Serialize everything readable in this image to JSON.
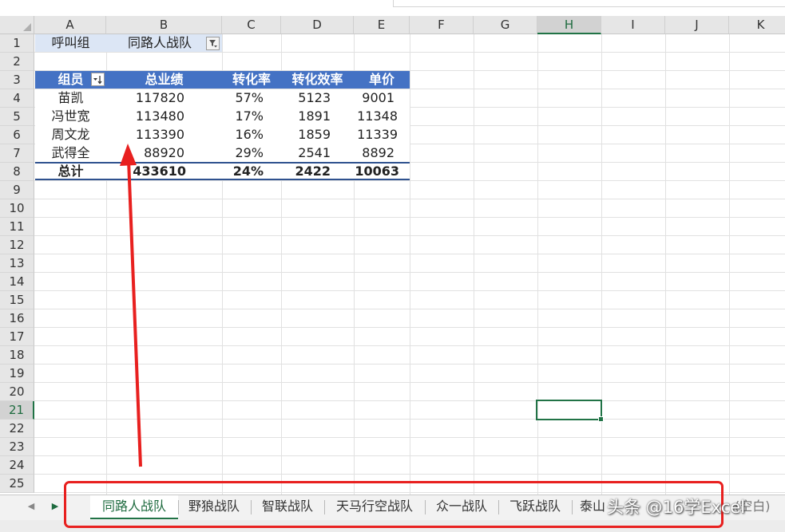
{
  "columns": [
    "A",
    "B",
    "C",
    "D",
    "E",
    "F",
    "G",
    "H",
    "I",
    "J",
    "K"
  ],
  "rows": [
    "1",
    "2",
    "3",
    "4",
    "5",
    "6",
    "7",
    "8",
    "9",
    "10",
    "11",
    "12",
    "13",
    "14",
    "15",
    "16",
    "17",
    "18",
    "19",
    "20",
    "21",
    "22",
    "23",
    "24",
    "25"
  ],
  "active_column": "H",
  "active_row": "21",
  "filter_row": {
    "label": "呼叫组",
    "value": "同路人战队"
  },
  "pivot": {
    "headers": [
      "组员",
      "总业绩",
      "转化率",
      "转化效率",
      "单价"
    ],
    "rows": [
      [
        "苗凯",
        "117820",
        "57%",
        "5123",
        "9001"
      ],
      [
        "冯世宽",
        "113480",
        "17%",
        "1891",
        "11348"
      ],
      [
        "周文龙",
        "113390",
        "16%",
        "1859",
        "11339"
      ],
      [
        "武得全",
        "88920",
        "29%",
        "2541",
        "8892"
      ]
    ],
    "total": [
      "总计",
      "433610",
      "24%",
      "2422",
      "10063"
    ]
  },
  "sheet_tabs": [
    "同路人战队",
    "野狼战队",
    "智联战队",
    "天马行空战队",
    "众一战队",
    "飞跃战队",
    "泰山"
  ],
  "active_sheet": "同路人战队",
  "tab_tail_text": "(空白)",
  "watermark": "头条 @16学Excel",
  "colors": {
    "accent": "#217346",
    "pivot_header": "#4472c4",
    "annotation": "#e8201f"
  }
}
